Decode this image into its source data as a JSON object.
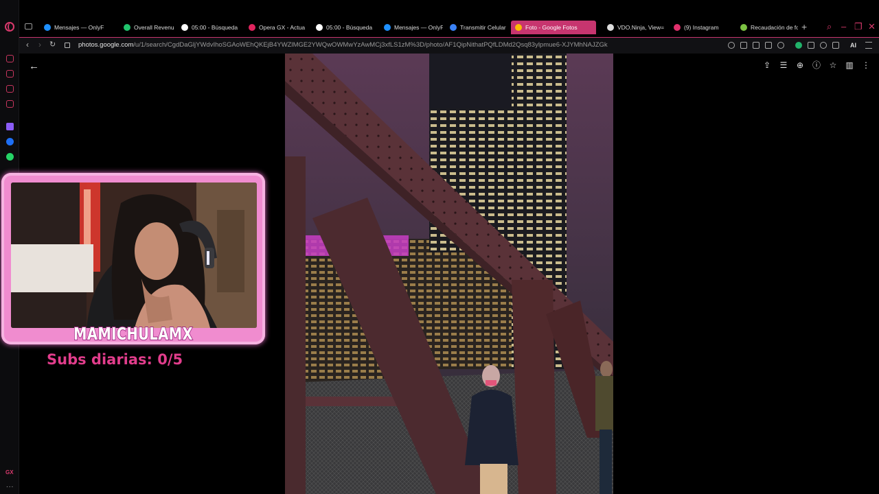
{
  "browser": {
    "tabs": [
      {
        "label": "Mensajes — OnlyF",
        "color": "#1e90ff"
      },
      {
        "label": "Overall Revenue -",
        "color": "#21c46d"
      },
      {
        "label": "05:00 - Búsqueda",
        "color": "#ffffff"
      },
      {
        "label": "Opera GX - Actua",
        "color": "#e0245e"
      },
      {
        "label": "05:00 - Búsqueda",
        "color": "#ffffff"
      },
      {
        "label": "Mensajes — OnlyF",
        "color": "#1e90ff"
      },
      {
        "label": "Transmitir Celular",
        "color": "#3b82f6"
      },
      {
        "label": "Foto - Google Fotos",
        "color": "#fbbc04",
        "active": true
      },
      {
        "label": "VDO.Ninja, View=",
        "color": "#dddddd"
      },
      {
        "label": "(9) Instagram",
        "color": "#e1306c"
      },
      {
        "label": "Recaudación de fo",
        "color": "#7cc243"
      }
    ],
    "new_tab": "+",
    "url_host": "photos.google.com",
    "url_path": "/u/1/search/CgdDaGljYWdvIhoSGAoWEhQKEjB4YWZlMGE2YWQwOWMwYzAwMCj3xfLS1zM%3D/photo/AF1QipNithatPQfLDMd2Qsq83ylpmue6-XJYMhNAJZGk",
    "ai_label": "AI",
    "sidebar_gx": "GX",
    "sidebar_more": "..."
  },
  "viewer": {
    "back": "←",
    "toolbar": [
      "share-icon",
      "tune-icon",
      "zoom-icon",
      "info-icon",
      "star-icon",
      "delete-icon",
      "more-icon"
    ]
  },
  "overlay": {
    "streamer_name": "MAMICHULAMX",
    "subs_text": "Subs diarias: 0/5"
  },
  "colors": {
    "accent": "#c7356f",
    "cam_frame": "#f08ccf",
    "subs": "#e23d8c"
  }
}
